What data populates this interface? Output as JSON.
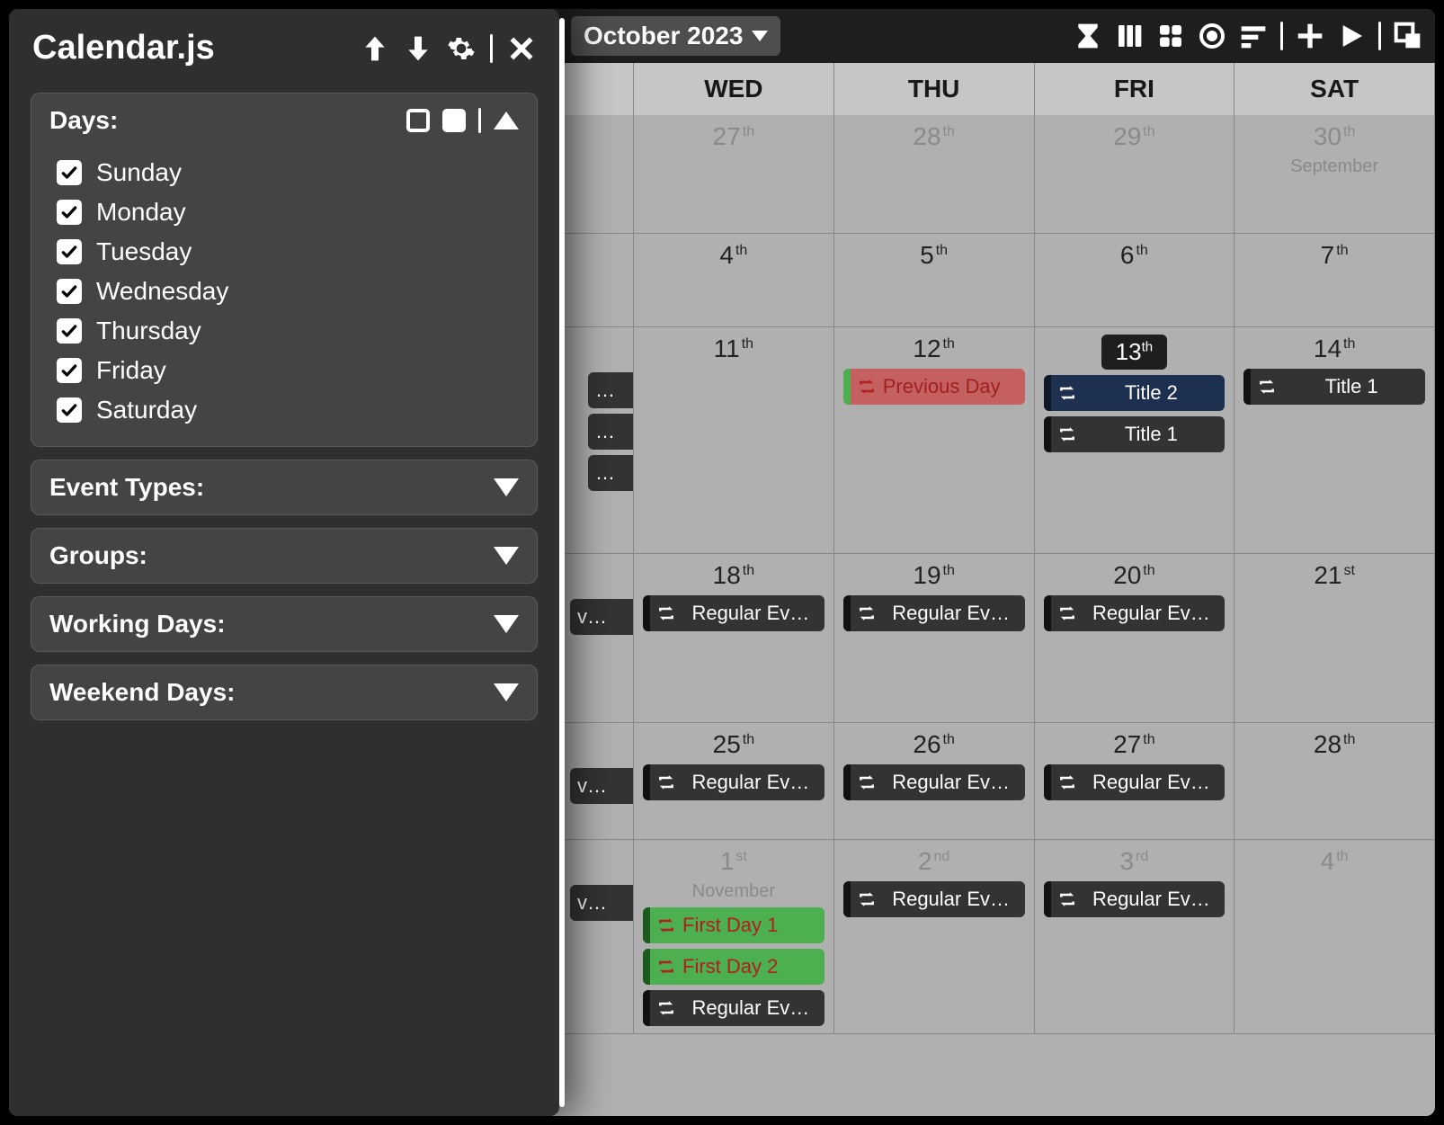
{
  "header": {
    "month_label": "October 2023"
  },
  "day_headers": [
    "WED",
    "THU",
    "FRI",
    "SAT"
  ],
  "side_panel": {
    "title": "Calendar.js",
    "sections": {
      "days_title": "Days:",
      "event_types_title": "Event Types:",
      "groups_title": "Groups:",
      "working_days_title": "Working Days:",
      "weekend_days_title": "Weekend Days:"
    },
    "days_options": [
      {
        "label": "Sunday",
        "checked": true
      },
      {
        "label": "Monday",
        "checked": true
      },
      {
        "label": "Tuesday",
        "checked": true
      },
      {
        "label": "Wednesday",
        "checked": true
      },
      {
        "label": "Thursday",
        "checked": true
      },
      {
        "label": "Friday",
        "checked": true
      },
      {
        "label": "Saturday",
        "checked": true
      }
    ]
  },
  "grid": {
    "rows": [
      {
        "cells": [
          {
            "day": "27",
            "ord": "th",
            "muted": true
          },
          {
            "day": "28",
            "ord": "th",
            "muted": true
          },
          {
            "day": "29",
            "ord": "th",
            "muted": true
          },
          {
            "day": "30",
            "ord": "th",
            "muted": true,
            "sublabel": "September"
          }
        ]
      },
      {
        "cells": [
          {
            "day": "4",
            "ord": "th"
          },
          {
            "day": "5",
            "ord": "th"
          },
          {
            "day": "6",
            "ord": "th"
          },
          {
            "day": "7",
            "ord": "th"
          }
        ]
      },
      {
        "cells": [
          {
            "day": "11",
            "ord": "th",
            "stubs": [
              "…",
              "…",
              "…"
            ]
          },
          {
            "day": "12",
            "ord": "th",
            "events": [
              {
                "type": "red",
                "label": "Previous Day"
              }
            ]
          },
          {
            "day": "13",
            "ord": "th",
            "today": true,
            "events": [
              {
                "type": "navy",
                "label": "Title 2"
              },
              {
                "type": "dark",
                "label": "Title 1"
              }
            ]
          },
          {
            "day": "14",
            "ord": "th",
            "events": [
              {
                "type": "dark",
                "label": "Title 1"
              }
            ]
          }
        ]
      },
      {
        "cells": [
          {
            "day": "18",
            "ord": "th",
            "stubs_wide": [
              "v…"
            ],
            "events": [
              {
                "type": "dark",
                "label": "Regular Ev…"
              }
            ]
          },
          {
            "day": "19",
            "ord": "th",
            "events": [
              {
                "type": "dark",
                "label": "Regular Ev…"
              }
            ]
          },
          {
            "day": "20",
            "ord": "th",
            "events": [
              {
                "type": "dark",
                "label": "Regular Ev…"
              }
            ]
          },
          {
            "day": "21",
            "ord": "st"
          }
        ]
      },
      {
        "cells": [
          {
            "day": "25",
            "ord": "th",
            "stubs_wide": [
              "v…"
            ],
            "events": [
              {
                "type": "dark",
                "label": "Regular Ev…"
              }
            ]
          },
          {
            "day": "26",
            "ord": "th",
            "events": [
              {
                "type": "dark",
                "label": "Regular Ev…"
              }
            ]
          },
          {
            "day": "27",
            "ord": "th",
            "events": [
              {
                "type": "dark",
                "label": "Regular Ev…"
              }
            ]
          },
          {
            "day": "28",
            "ord": "th"
          }
        ]
      },
      {
        "cells": [
          {
            "day": "1",
            "ord": "st",
            "muted": true,
            "sublabel": "November",
            "stubs_wide": [
              "v…"
            ],
            "events": [
              {
                "type": "green",
                "label": "First Day 1"
              },
              {
                "type": "green",
                "label": "First Day 2"
              },
              {
                "type": "dark",
                "label": "Regular Ev…"
              }
            ]
          },
          {
            "day": "2",
            "ord": "nd",
            "muted": true,
            "events": [
              {
                "type": "dark",
                "label": "Regular Ev…"
              }
            ]
          },
          {
            "day": "3",
            "ord": "rd",
            "muted": true,
            "events": [
              {
                "type": "dark",
                "label": "Regular Ev…"
              }
            ]
          },
          {
            "day": "4",
            "ord": "th",
            "muted": true
          }
        ]
      }
    ]
  }
}
